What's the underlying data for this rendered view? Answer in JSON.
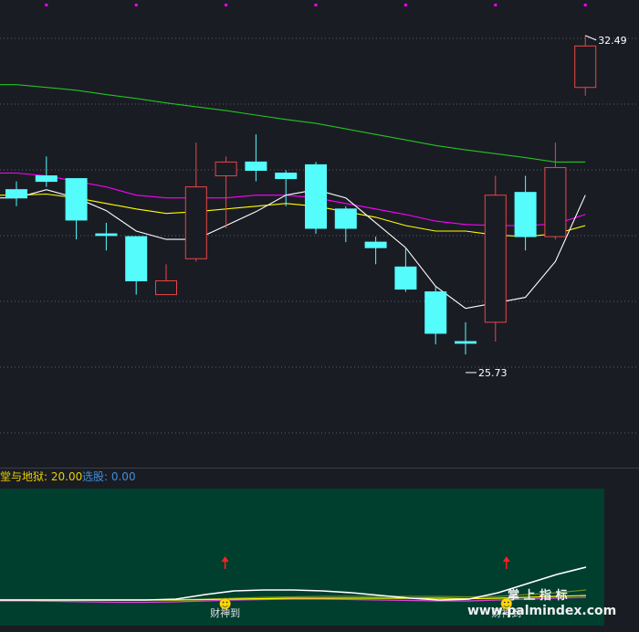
{
  "chart_data": {
    "type": "candlestick",
    "price_range": [
      25.0,
      33.0
    ],
    "price_max_label": "32.49",
    "price_min_label": "25.73",
    "candles": [
      {
        "o": 29.7,
        "h": 29.85,
        "l": 29.4,
        "c": 29.55
      },
      {
        "o": 29.95,
        "h": 30.3,
        "l": 29.75,
        "c": 29.85
      },
      {
        "o": 29.9,
        "h": 29.9,
        "l": 28.8,
        "c": 29.15
      },
      {
        "o": 28.9,
        "h": 29.1,
        "l": 28.6,
        "c": 28.87
      },
      {
        "o": 28.85,
        "h": 28.85,
        "l": 27.8,
        "c": 28.05
      },
      {
        "o": 27.8,
        "h": 28.35,
        "l": 27.8,
        "c": 28.05
      },
      {
        "o": 28.45,
        "h": 30.55,
        "l": 28.4,
        "c": 29.75
      },
      {
        "o": 29.95,
        "h": 30.3,
        "l": 29.0,
        "c": 30.2
      },
      {
        "o": 30.2,
        "h": 30.7,
        "l": 29.85,
        "c": 30.05
      },
      {
        "o": 30.0,
        "h": 30.05,
        "l": 29.4,
        "c": 29.9
      },
      {
        "o": 30.15,
        "h": 30.2,
        "l": 28.9,
        "c": 29.0
      },
      {
        "o": 29.35,
        "h": 29.4,
        "l": 28.75,
        "c": 29.0
      },
      {
        "o": 28.75,
        "h": 28.85,
        "l": 28.35,
        "c": 28.65
      },
      {
        "o": 28.3,
        "h": 28.65,
        "l": 27.85,
        "c": 27.9
      },
      {
        "o": 27.85,
        "h": 27.95,
        "l": 26.9,
        "c": 27.1
      },
      {
        "o": 26.95,
        "h": 27.3,
        "l": 26.72,
        "c": 26.92
      },
      {
        "o": 27.3,
        "h": 29.95,
        "l": 26.95,
        "c": 29.6
      },
      {
        "o": 29.65,
        "h": 29.95,
        "l": 28.6,
        "c": 28.85
      },
      {
        "o": 28.85,
        "h": 30.55,
        "l": 28.8,
        "c": 30.1
      },
      {
        "o": 31.55,
        "h": 32.49,
        "l": 31.4,
        "c": 32.3
      }
    ],
    "ma_white": [
      29.55,
      29.7,
      29.55,
      29.32,
      28.95,
      28.8,
      28.8,
      29.05,
      29.3,
      29.6,
      29.7,
      29.55,
      29.1,
      28.65,
      27.95,
      27.55,
      27.65,
      27.75,
      28.4,
      29.6
    ],
    "ma_yellow": [
      29.6,
      29.62,
      29.55,
      29.45,
      29.35,
      29.27,
      29.3,
      29.35,
      29.4,
      29.45,
      29.4,
      29.3,
      29.2,
      29.05,
      28.95,
      28.95,
      28.88,
      28.85,
      28.9,
      29.05
    ],
    "ma_magenta": [
      30.0,
      29.95,
      29.85,
      29.75,
      29.6,
      29.55,
      29.55,
      29.55,
      29.6,
      29.6,
      29.55,
      29.45,
      29.35,
      29.25,
      29.13,
      29.07,
      29.05,
      29.05,
      29.08,
      29.25
    ],
    "ma_green": [
      31.6,
      31.55,
      31.5,
      31.42,
      31.35,
      31.27,
      31.2,
      31.13,
      31.05,
      30.97,
      30.9,
      30.8,
      30.7,
      30.6,
      30.5,
      30.42,
      30.35,
      30.28,
      30.2,
      30.2
    ],
    "top_markers": [
      1,
      4,
      7,
      10,
      13,
      16,
      19
    ],
    "indicator": {
      "label_name": "堂与地狱: 20.00",
      "label_select": "选股: 0.00",
      "signal_text": "财神到",
      "signals": [
        7,
        16
      ],
      "white": [
        46,
        46,
        46,
        46,
        46,
        46,
        45,
        40,
        36,
        35,
        35,
        36,
        38,
        41,
        44,
        46,
        45,
        38,
        28,
        18,
        10
      ],
      "green": [
        45.5,
        45.5,
        45.5,
        45.5,
        45.5,
        45.5,
        45.5,
        45,
        44,
        43,
        42.5,
        42,
        42,
        42,
        42,
        42,
        42.5,
        42,
        40,
        38,
        35
      ],
      "yellow": [
        46,
        46,
        46,
        46,
        46,
        46,
        46,
        45.5,
        45,
        44.5,
        44,
        44,
        44,
        44,
        44,
        44,
        44.5,
        44,
        43,
        42,
        41
      ],
      "magenta": [
        47,
        47,
        47.5,
        48,
        48.5,
        48.5,
        48,
        47,
        46,
        45.5,
        45,
        45,
        45.5,
        46,
        46.5,
        47,
        47,
        46,
        45,
        44,
        43
      ]
    },
    "watermark_main": "掌 上 指 标",
    "watermark_url": "www.palmindex.com"
  },
  "colors": {
    "background": "#1a1c24",
    "up": "#e84646",
    "down": "#54fcfc",
    "ma_white": "#ffffff",
    "ma_yellow": "#ffff00",
    "ma_magenta": "#ff00ff",
    "ma_green": "#22c322",
    "indicator_bg": "#003e2e",
    "label_yellow": "#e8d000",
    "label_blue": "#3f8fd8",
    "arrow": "#ff2020"
  }
}
